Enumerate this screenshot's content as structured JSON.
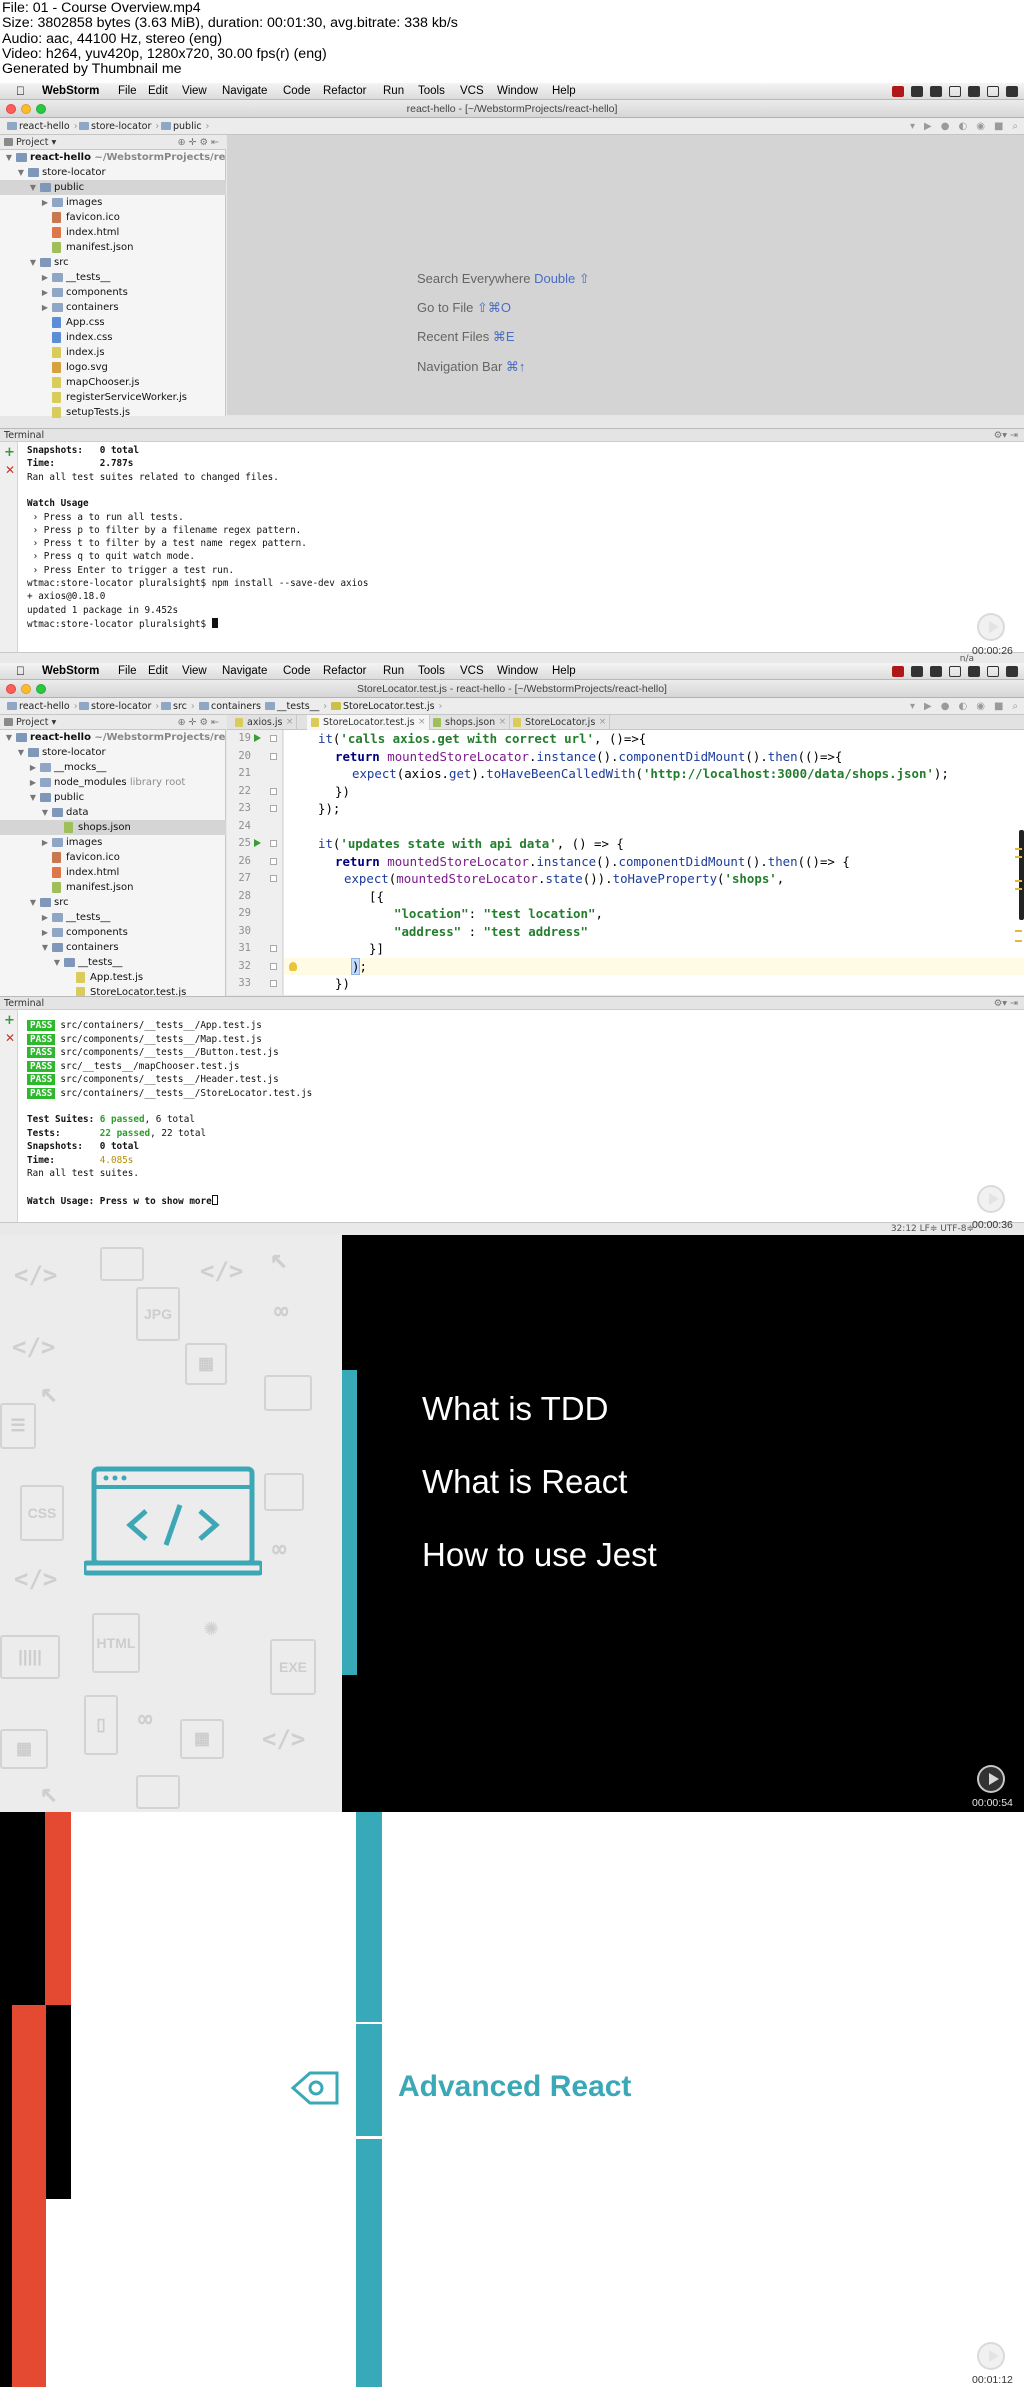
{
  "info": {
    "lines": [
      "File: 01 - Course Overview.mp4",
      "Size: 3802858 bytes (3.63 MiB), duration: 00:01:30, avg.bitrate: 338 kb/s",
      "Audio: aac, 44100 Hz, stereo (eng)",
      "Video: h264, yuv420p, 1280x720, 30.00 fps(r) (eng)",
      "Generated by Thumbnail me"
    ]
  },
  "menubar": {
    "apple": "",
    "app": "WebStorm",
    "items": [
      "File",
      "Edit",
      "View",
      "Navigate",
      "Code",
      "Refactor",
      "Run",
      "Tools",
      "VCS",
      "Window",
      "Help"
    ]
  },
  "frame1": {
    "window_title": "react-hello - [~/WebstormProjects/react-hello]",
    "breadcrumbs": [
      "react-hello",
      "store-locator",
      "public"
    ],
    "project_label": "Project",
    "tree": [
      {
        "label": "react-hello",
        "suffix": "~/WebstormProjects/react-h",
        "depth": 0,
        "kind": "folder",
        "open": true
      },
      {
        "label": "store-locator",
        "depth": 1,
        "kind": "folder",
        "open": true
      },
      {
        "label": "public",
        "depth": 2,
        "kind": "folder",
        "open": true,
        "selected": true
      },
      {
        "label": "images",
        "depth": 3,
        "kind": "folder",
        "open": false
      },
      {
        "label": "favicon.ico",
        "depth": 3,
        "kind": "ico"
      },
      {
        "label": "index.html",
        "depth": 3,
        "kind": "html"
      },
      {
        "label": "manifest.json",
        "depth": 3,
        "kind": "json"
      },
      {
        "label": "src",
        "depth": 2,
        "kind": "folder",
        "open": true
      },
      {
        "label": "__tests__",
        "depth": 3,
        "kind": "folder",
        "open": false
      },
      {
        "label": "components",
        "depth": 3,
        "kind": "folder",
        "open": false
      },
      {
        "label": "containers",
        "depth": 3,
        "kind": "folder",
        "open": false
      },
      {
        "label": "App.css",
        "depth": 3,
        "kind": "css"
      },
      {
        "label": "index.css",
        "depth": 3,
        "kind": "css"
      },
      {
        "label": "index.js",
        "depth": 3,
        "kind": "js"
      },
      {
        "label": "logo.svg",
        "depth": 3,
        "kind": "svg"
      },
      {
        "label": "mapChooser.js",
        "depth": 3,
        "kind": "js"
      },
      {
        "label": "registerServiceWorker.js",
        "depth": 3,
        "kind": "js"
      },
      {
        "label": "setupTests.js",
        "depth": 3,
        "kind": "js"
      }
    ],
    "welcome": [
      {
        "text": "Search Everywhere",
        "key": "Double ⇧"
      },
      {
        "text": "Go to File",
        "key": "⇧⌘O"
      },
      {
        "text": "Recent Files",
        "key": "⌘E"
      },
      {
        "text": "Navigation Bar",
        "key": "⌘↑"
      }
    ],
    "terminal_label": "Terminal",
    "terminal": [
      "Snapshots:   0 total",
      "Time:        2.787s",
      "Ran all test suites related to changed files.",
      "",
      "Watch Usage",
      " › Press a to run all tests.",
      " › Press p to filter by a filename regex pattern.",
      " › Press t to filter by a test name regex pattern.",
      " › Press q to quit watch mode.",
      " › Press Enter to trigger a test run.",
      "wtmac:store-locator pluralsight$ npm install --save-dev axios",
      "+ axios@0.18.0",
      "updated 1 package in 9.452s",
      "wtmac:store-locator pluralsight$ "
    ],
    "status_right": "n/a",
    "timestamp": "00:00:26"
  },
  "frame2": {
    "window_title": "StoreLocator.test.js - react-hello - [~/WebstormProjects/react-hello]",
    "breadcrumbs": [
      "react-hello",
      "store-locator",
      "src",
      "containers",
      "__tests__",
      "StoreLocator.test.js"
    ],
    "tabs": [
      "axios.js",
      "StoreLocator.test.js",
      "shops.json",
      "StoreLocator.js"
    ],
    "active_tab": 1,
    "project_label": "Project",
    "tree": [
      {
        "label": "react-hello",
        "suffix": "~/WebstormProjects/react-",
        "depth": 0,
        "kind": "folder",
        "open": true
      },
      {
        "label": "store-locator",
        "depth": 1,
        "kind": "folder",
        "open": true
      },
      {
        "label": "__mocks__",
        "depth": 2,
        "kind": "folder",
        "open": false
      },
      {
        "label": "node_modules",
        "suffix": "library root",
        "depth": 2,
        "kind": "folder",
        "open": false
      },
      {
        "label": "public",
        "depth": 2,
        "kind": "folder",
        "open": true
      },
      {
        "label": "data",
        "depth": 3,
        "kind": "folder",
        "open": true
      },
      {
        "label": "shops.json",
        "depth": 4,
        "kind": "json",
        "selected": true
      },
      {
        "label": "images",
        "depth": 3,
        "kind": "folder",
        "open": false
      },
      {
        "label": "favicon.ico",
        "depth": 3,
        "kind": "ico"
      },
      {
        "label": "index.html",
        "depth": 3,
        "kind": "html"
      },
      {
        "label": "manifest.json",
        "depth": 3,
        "kind": "json"
      },
      {
        "label": "src",
        "depth": 2,
        "kind": "folder",
        "open": true
      },
      {
        "label": "__tests__",
        "depth": 3,
        "kind": "folder",
        "open": false
      },
      {
        "label": "components",
        "depth": 3,
        "kind": "folder",
        "open": false
      },
      {
        "label": "containers",
        "depth": 3,
        "kind": "folder",
        "open": true
      },
      {
        "label": "__tests__",
        "depth": 4,
        "kind": "folder",
        "open": true
      },
      {
        "label": "App.test.js",
        "depth": 5,
        "kind": "js"
      },
      {
        "label": "StoreLocator.test.js",
        "depth": 5,
        "kind": "js"
      }
    ],
    "line_numbers": [
      "19",
      "20",
      "21",
      "22",
      "23",
      "24",
      "25",
      "26",
      "27",
      "28",
      "29",
      "30",
      "31",
      "32",
      "33"
    ],
    "terminal_label": "Terminal",
    "pass_label": "PASS",
    "passes": [
      "src/containers/__tests__/App.test.js",
      "src/components/__tests__/Map.test.js",
      "src/components/__tests__/Button.test.js",
      "src/__tests__/mapChooser.test.js",
      "src/components/__tests__/Header.test.js",
      "src/containers/__tests__/StoreLocator.test.js"
    ],
    "summary": {
      "suites_label": "Test Suites:",
      "suites_passed": "6 passed",
      "suites_total": ", 6 total",
      "tests_label": "Tests:",
      "tests_passed": "22 passed",
      "tests_total": ", 22 total",
      "snapshots": "Snapshots:   0 total",
      "time_label": "Time:",
      "time_value": "4.085s",
      "ran": "Ran all test suites."
    },
    "watch_usage": "Watch Usage: Press w to show more",
    "status_right": "32:12  LF≑  UTF-8≑",
    "timestamp": "00:00:36"
  },
  "frame3": {
    "items": [
      "What is TDD",
      "What is React",
      "How to use Jest"
    ],
    "timestamp": "00:00:54"
  },
  "frame4": {
    "title": "Advanced React",
    "timestamp": "00:01:12"
  },
  "colors": {
    "teal": "#38a9b9",
    "red": "#e44a31",
    "pass_green": "#2db82d"
  }
}
